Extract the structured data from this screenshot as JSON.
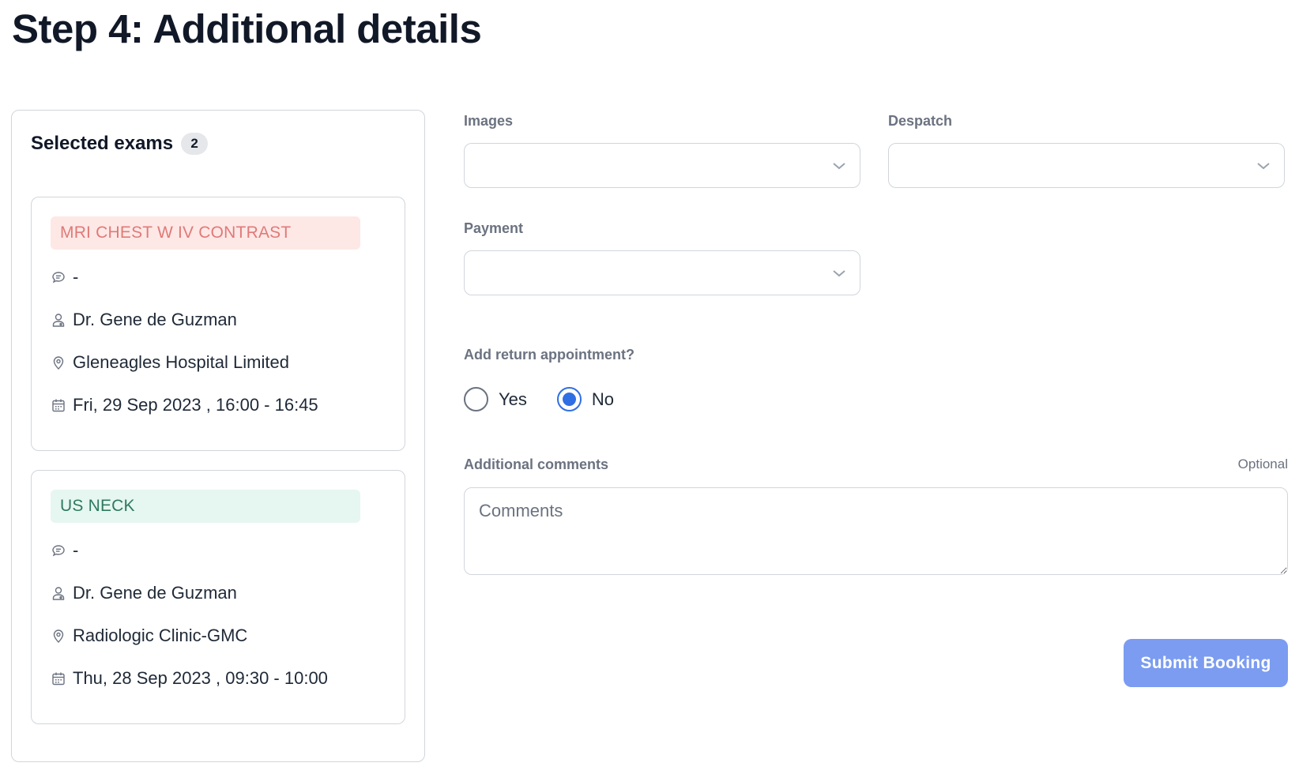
{
  "page": {
    "title": "Step 4: Additional details"
  },
  "selected_exams": {
    "title": "Selected exams",
    "count": "2",
    "items": [
      {
        "name": "MRI CHEST W IV CONTRAST",
        "tag_color": "#fde8e6",
        "comment": "-",
        "doctor": "Dr. Gene de Guzman",
        "location": "Gleneagles Hospital Limited",
        "datetime": "Fri, 29 Sep 2023 , 16:00 - 16:45"
      },
      {
        "name": "US NECK",
        "tag_color": "#e6f6f1",
        "comment": "-",
        "doctor": "Dr. Gene de Guzman",
        "location": "Radiologic Clinic-GMC",
        "datetime": "Thu, 28 Sep 2023 , 09:30 - 10:00"
      }
    ]
  },
  "form": {
    "images": {
      "label": "Images",
      "value": ""
    },
    "despatch": {
      "label": "Despatch",
      "value": ""
    },
    "payment": {
      "label": "Payment",
      "value": ""
    },
    "return_appointment": {
      "label": "Add return appointment?",
      "options": [
        {
          "label": "Yes",
          "selected": false
        },
        {
          "label": "No",
          "selected": true
        }
      ]
    },
    "comments": {
      "label": "Additional comments",
      "optional_label": "Optional",
      "placeholder": "Comments",
      "value": ""
    },
    "submit_label": "Submit Booking"
  },
  "colors": {
    "accent": "#2f6fe4",
    "submit_button": "#7b9cf0"
  }
}
